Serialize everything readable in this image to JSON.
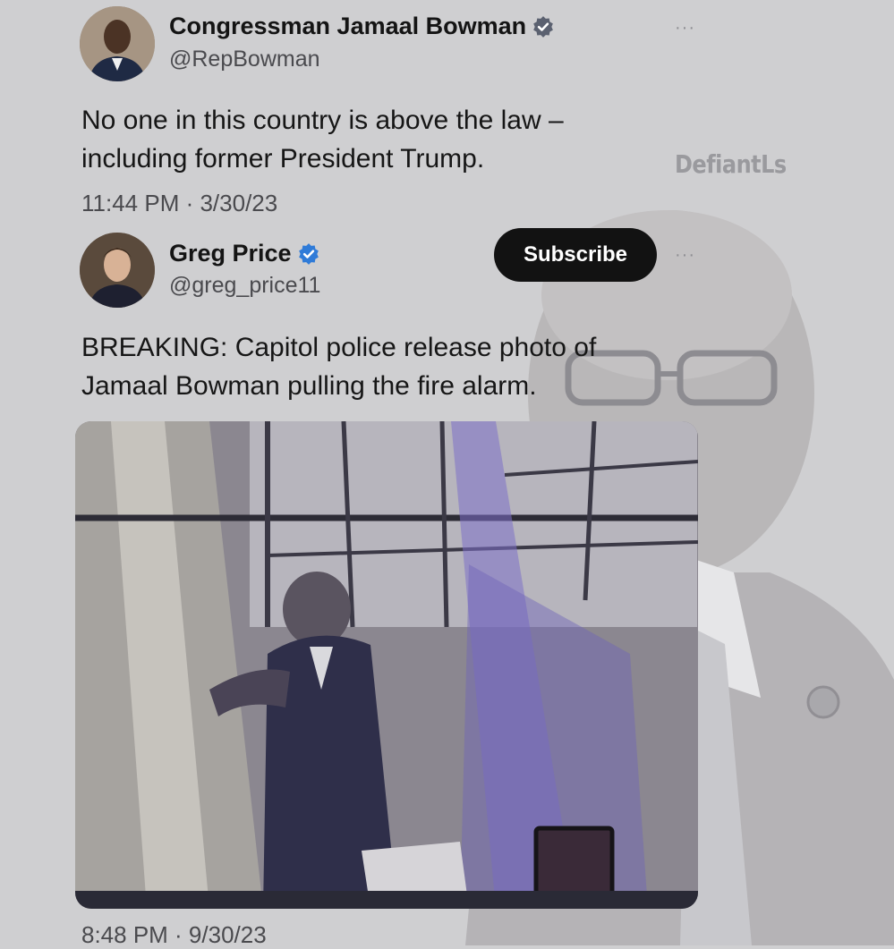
{
  "watermark": "DefiantLs",
  "tweet1": {
    "display_name": "Congressman Jamaal Bowman",
    "handle": "@RepBowman",
    "line1": "No one in this country is above the law –",
    "line2": "including former President Trump.",
    "timestamp": "11:44 PM · 3/30/23",
    "more": "···",
    "verified_color": "#5b6170"
  },
  "tweet2": {
    "display_name": "Greg Price",
    "handle": "@greg_price11",
    "subscribe_label": "Subscribe",
    "line1": "BREAKING: Capitol police release photo of",
    "line2": "Jamaal Bowman pulling the fire alarm.",
    "timestamp": "8:48 PM · 9/30/23",
    "more": "···",
    "verified_color": "#2f7bd8"
  },
  "icons": [
    "verified-badge-icon",
    "more-options-icon"
  ]
}
